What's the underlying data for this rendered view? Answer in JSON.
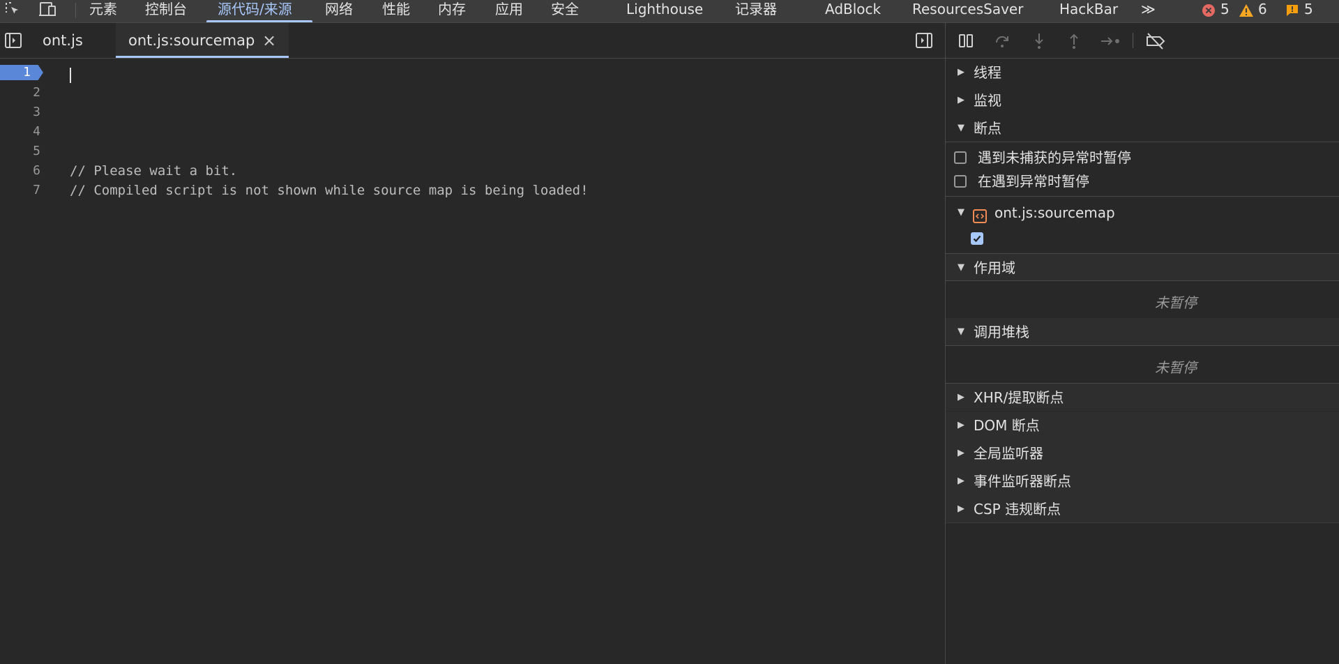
{
  "toolbar": {
    "tabs": [
      "元素",
      "控制台",
      "源代码/来源",
      "网络",
      "性能",
      "内存",
      "应用",
      "安全",
      "Lighthouse",
      "记录器",
      "AdBlock",
      "ResourcesSaver",
      "HackBar"
    ],
    "more": "≫",
    "errors": "5",
    "warnings": "6",
    "issues": "5"
  },
  "file_tabs": [
    "ont.js",
    "ont.js:sourcemap"
  ],
  "close_glyph": "×",
  "editor": {
    "line_numbers": [
      "1",
      "2",
      "3",
      "4",
      "5",
      "6",
      "7"
    ],
    "lines": [
      "",
      "",
      "",
      "",
      "",
      "// Please wait a bit.",
      "// Compiled script is not shown while source map is being loaded!"
    ]
  },
  "debugger": {
    "threads": "线程",
    "watch": "监视",
    "breakpoints": "断点",
    "pause_uncaught": "遇到未捕获的异常时暂停",
    "pause_caught": "在遇到异常时暂停",
    "bp_file": "ont.js:sourcemap",
    "scope": "作用域",
    "scope_empty": "未暂停",
    "callstack": "调用堆栈",
    "callstack_empty": "未暂停",
    "xhr": "XHR/提取断点",
    "dom": "DOM 断点",
    "global": "全局监听器",
    "event": "事件监听器断点",
    "csp": "CSP 违规断点"
  },
  "colors": {
    "accent": "#a8c7fa",
    "error": "#e46962",
    "warning": "#f5a623",
    "issue": "#f59e0b"
  }
}
